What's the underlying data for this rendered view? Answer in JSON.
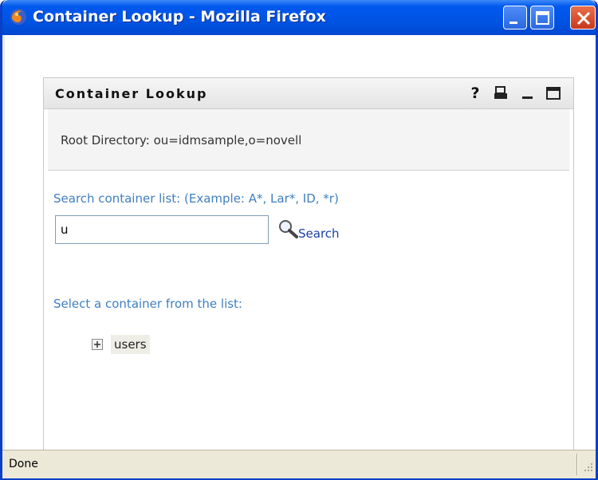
{
  "window": {
    "title": "Container Lookup - Mozilla Firefox",
    "icon": "firefox-icon",
    "controls": [
      "minimize-icon",
      "maximize-icon",
      "close-icon"
    ]
  },
  "portlet": {
    "title": "Container Lookup",
    "header_icons": {
      "help": "?",
      "print": "print-icon",
      "minimize": "minimize-icon",
      "maximize": "maximize-icon"
    },
    "root_directory": "Root Directory: ou=idmsample,o=novell",
    "search_label": "Search container list: (Example: A*, Lar*, ID, *r)",
    "search_value": "u",
    "search_button": "Search",
    "search_icon": "magnifier-icon",
    "select_label": "Select a container from the list:",
    "tree": [
      {
        "label": "users",
        "icon": "expand-plus-icon"
      }
    ]
  },
  "status": {
    "text": "Done"
  },
  "colors": {
    "titlebar": "#0054e3",
    "label_blue": "#3f7fbf",
    "link_blue": "#1a3fa8",
    "chrome": "#ece9d8"
  }
}
